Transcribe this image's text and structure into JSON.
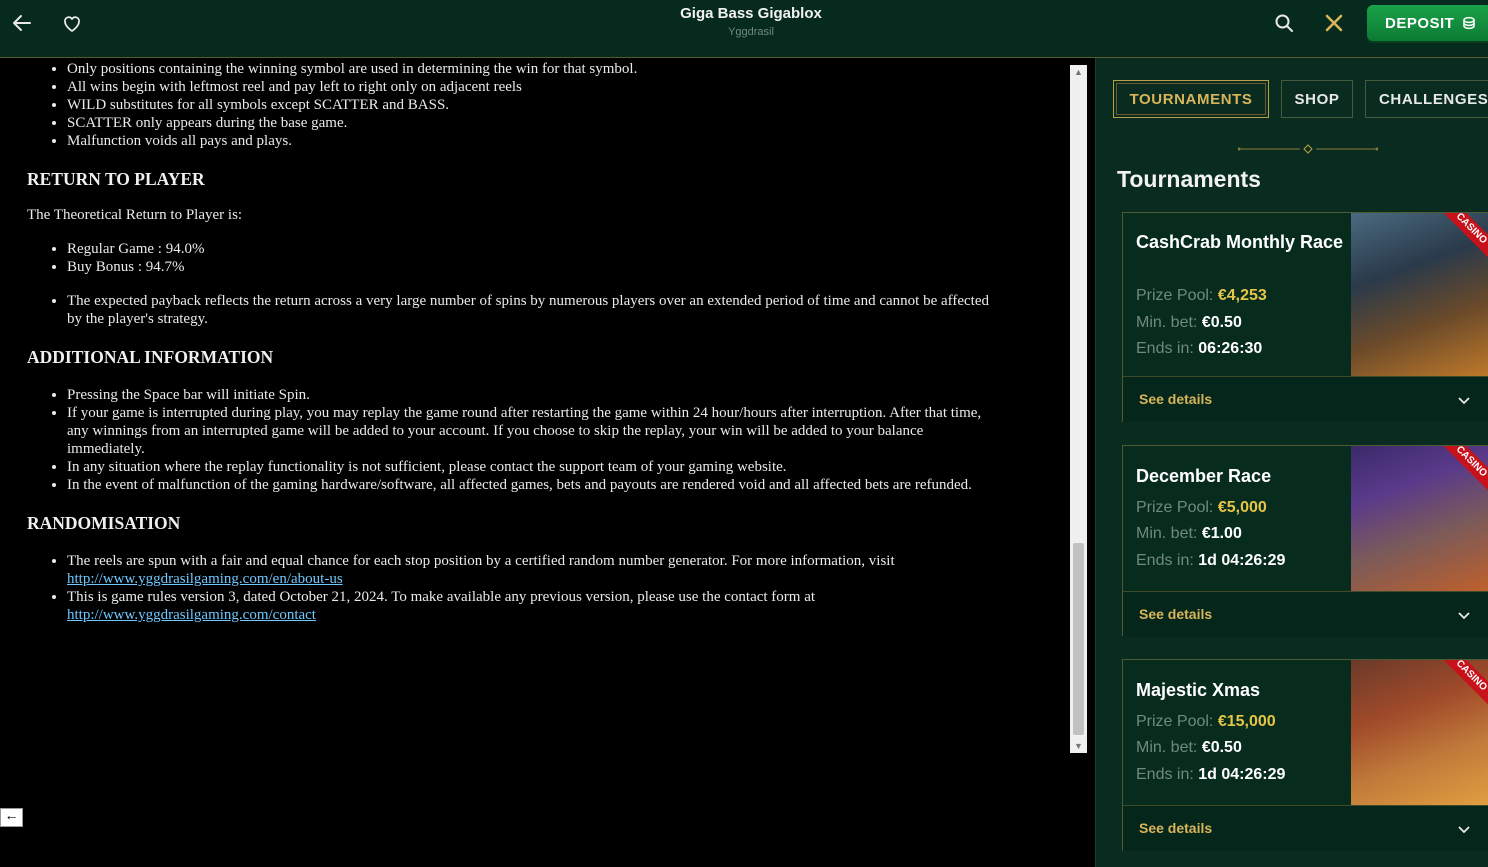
{
  "header": {
    "title": "Giga Bass Gigablox",
    "provider": "Yggdrasil",
    "deposit_label": "DEPOSIT"
  },
  "rules": {
    "top_list": [
      "Only positions containing the winning symbol are used in determining the win for that symbol.",
      "All wins begin with leftmost reel and pay left to right only on adjacent reels",
      "WILD substitutes for all symbols except SCATTER and BASS.",
      "SCATTER only appears during the base game.",
      "Malfunction voids all pays and plays."
    ],
    "rtp_heading": "RETURN TO PLAYER",
    "rtp_intro": "The Theoretical Return to Player is:",
    "rtp_list": [
      "Regular Game : 94.0%",
      "Buy Bonus : 94.7%"
    ],
    "rtp_note": "The expected payback reflects the return across a very large number of spins by numerous players over an extended period of time and cannot be affected by the player's strategy.",
    "additional_heading": "ADDITIONAL INFORMATION",
    "additional_list": [
      "Pressing the Space bar will initiate Spin.",
      "If your game is interrupted during play, you may replay the game round after restarting the game within 24 hour/hours after interruption. After that time, any winnings from an interrupted game will be added to your account. If you choose to skip the replay, your win will be added to your balance immediately.",
      "In any situation where the replay functionality is not sufficient, please contact the support team of your gaming website.",
      "In the event of malfunction of the gaming hardware/software, all affected games, bets and payouts are rendered void and all affected bets are refunded."
    ],
    "random_heading": "RANDOMISATION",
    "random_item1_text": "The reels are spun with a fair and equal chance for each stop position by a certified random number generator. For more information, visit",
    "random_item1_link": "http://www.yggdrasilgaming.com/en/about-us",
    "random_item2_text": "This is game rules version 3, dated October 21, 2024. To make available any previous version, please use the contact form at",
    "random_item2_link": "http://www.yggdrasilgaming.com/contact",
    "back_arrow": "←"
  },
  "side": {
    "tabs": [
      {
        "label": "TOURNAMENTS",
        "active": true
      },
      {
        "label": "SHOP",
        "active": false
      },
      {
        "label": "CHALLENGES",
        "active": false
      }
    ],
    "section_title": "Tournaments",
    "prize_label": "Prize Pool:",
    "minbet_label": "Min. bet:",
    "ends_label": "Ends in:",
    "details_label": "See details",
    "ribbon_label": "CASINO",
    "cards": [
      {
        "name": "CashCrab Monthly Race",
        "prize": "€4,253",
        "min_bet": "€0.50",
        "ends": "06:26:30"
      },
      {
        "name": "December Race",
        "prize": "€5,000",
        "min_bet": "€1.00",
        "ends": "1d 04:26:29"
      },
      {
        "name": "Majestic Xmas",
        "prize": "€15,000",
        "min_bet": "€0.50",
        "ends": "1d 04:26:29"
      }
    ]
  },
  "colors": {
    "header_bg": "#062a1d",
    "accent_gold": "#d8b55a",
    "prize_gold": "#e6c548",
    "deposit_green": "#1aa24a",
    "ribbon_red": "#c8121b"
  }
}
